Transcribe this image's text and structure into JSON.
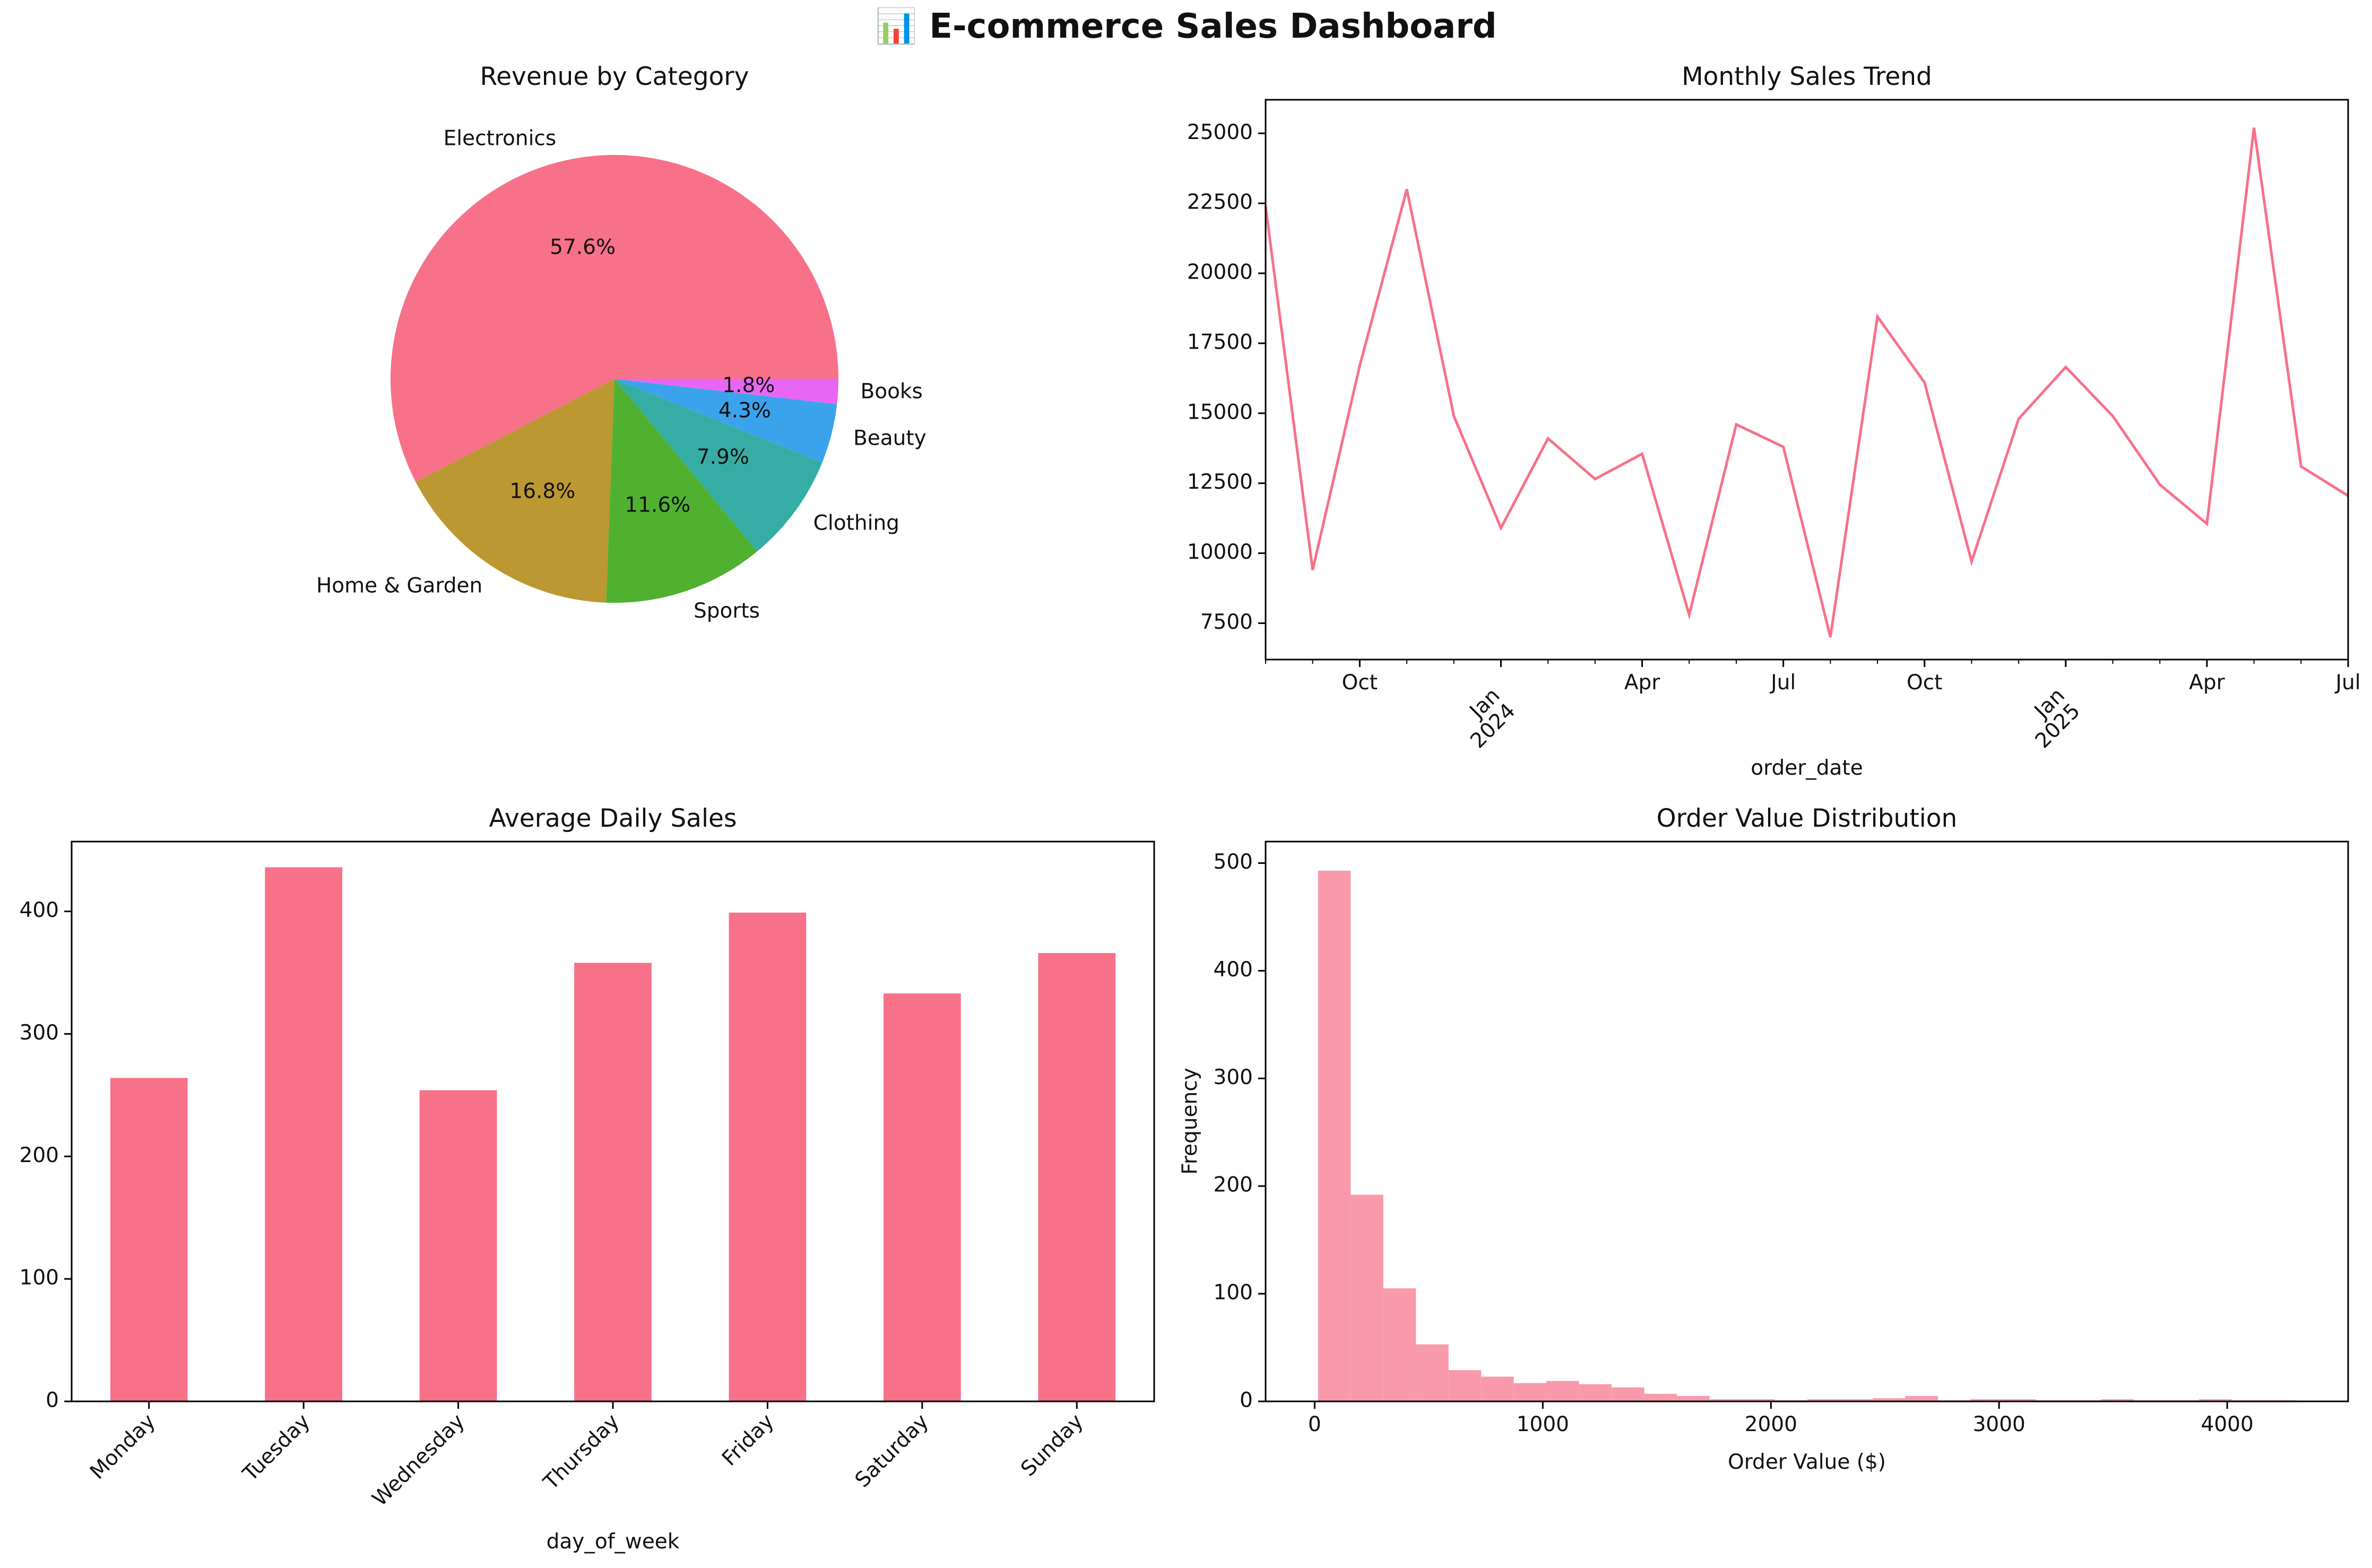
{
  "dashboard": {
    "title": "📊 E-commerce Sales Dashboard"
  },
  "colors": {
    "pink": "#f77189",
    "olive": "#bb9832",
    "green": "#50b131",
    "teal": "#36ada4",
    "blue": "#3ba3ec",
    "magenta": "#e866f4",
    "hist": "#f89aab"
  },
  "chart_data": [
    {
      "type": "pie",
      "title": "Revenue by Category",
      "labels": [
        "Electronics",
        "Home & Garden",
        "Sports",
        "Clothing",
        "Beauty",
        "Books"
      ],
      "pct_labels": [
        "57.6%",
        "16.8%",
        "11.6%",
        "7.9%",
        "4.3%",
        "1.8%"
      ],
      "values": [
        57.6,
        16.8,
        11.6,
        7.9,
        4.3,
        1.8
      ],
      "colors": [
        "#f77189",
        "#bb9832",
        "#50b131",
        "#36ada4",
        "#3ba3ec",
        "#e866f4"
      ]
    },
    {
      "type": "line",
      "title": "Monthly Sales Trend",
      "xlabel": "order_date",
      "ylabel": "",
      "x": [
        "2023-08",
        "2023-09",
        "2023-10",
        "2023-11",
        "2023-12",
        "2024-01",
        "2024-02",
        "2024-03",
        "2024-04",
        "2024-05",
        "2024-06",
        "2024-07",
        "2024-08",
        "2024-09",
        "2024-10",
        "2024-11",
        "2024-12",
        "2025-01",
        "2025-02",
        "2025-03",
        "2025-04",
        "2025-05",
        "2025-06",
        "2025-07"
      ],
      "values": [
        22400,
        9400,
        16700,
        23000,
        14900,
        10900,
        14100,
        12650,
        13550,
        7800,
        14600,
        13800,
        7000,
        18450,
        16100,
        9700,
        14800,
        16650,
        14900,
        12450,
        11050,
        25200,
        13100,
        12050
      ],
      "ylim": [
        6200,
        26200
      ],
      "yticks": [
        7500,
        10000,
        12500,
        15000,
        17500,
        20000,
        22500,
        25000
      ],
      "ytick_labels": [
        "7500",
        "10000",
        "12500",
        "15000",
        "17500",
        "20000",
        "22500",
        "25000"
      ],
      "xtick_labels": [
        "Oct",
        "Jan\n2024",
        "Apr",
        "Jul",
        "Oct",
        "Jan\n2025",
        "Apr",
        "Jul"
      ],
      "color": "#f77189"
    },
    {
      "type": "bar",
      "title": "Average Daily Sales",
      "xlabel": "day_of_week",
      "ylabel": "",
      "categories": [
        "Monday",
        "Tuesday",
        "Wednesday",
        "Thursday",
        "Friday",
        "Saturday",
        "Sunday"
      ],
      "values": [
        264,
        436,
        254,
        358,
        399,
        333,
        366
      ],
      "ylim": [
        0,
        457
      ],
      "yticks": [
        0,
        100,
        200,
        300,
        400
      ],
      "ytick_labels": [
        "0",
        "100",
        "200",
        "300",
        "400"
      ],
      "color": "#f77189"
    },
    {
      "type": "bar",
      "title": "Order Value Distribution",
      "xlabel": "Order Value ($)",
      "ylabel": "Frequency",
      "bin_start": 15,
      "bin_width": 143,
      "counts": [
        493,
        192,
        105,
        53,
        29,
        23,
        17,
        19,
        16,
        13,
        7,
        5,
        2,
        2,
        1,
        2,
        2,
        3,
        5,
        1,
        2,
        2,
        1,
        1,
        2,
        1,
        1,
        2,
        1,
        1
      ],
      "xlim": [
        -215,
        4530
      ],
      "ylim": [
        0,
        520
      ],
      "xticks": [
        0,
        1000,
        2000,
        3000,
        4000
      ],
      "xtick_labels": [
        "0",
        "1000",
        "2000",
        "3000",
        "4000"
      ],
      "yticks": [
        0,
        100,
        200,
        300,
        400,
        500
      ],
      "ytick_labels": [
        "0",
        "100",
        "200",
        "300",
        "400",
        "500"
      ],
      "color": "#f89aab"
    }
  ]
}
